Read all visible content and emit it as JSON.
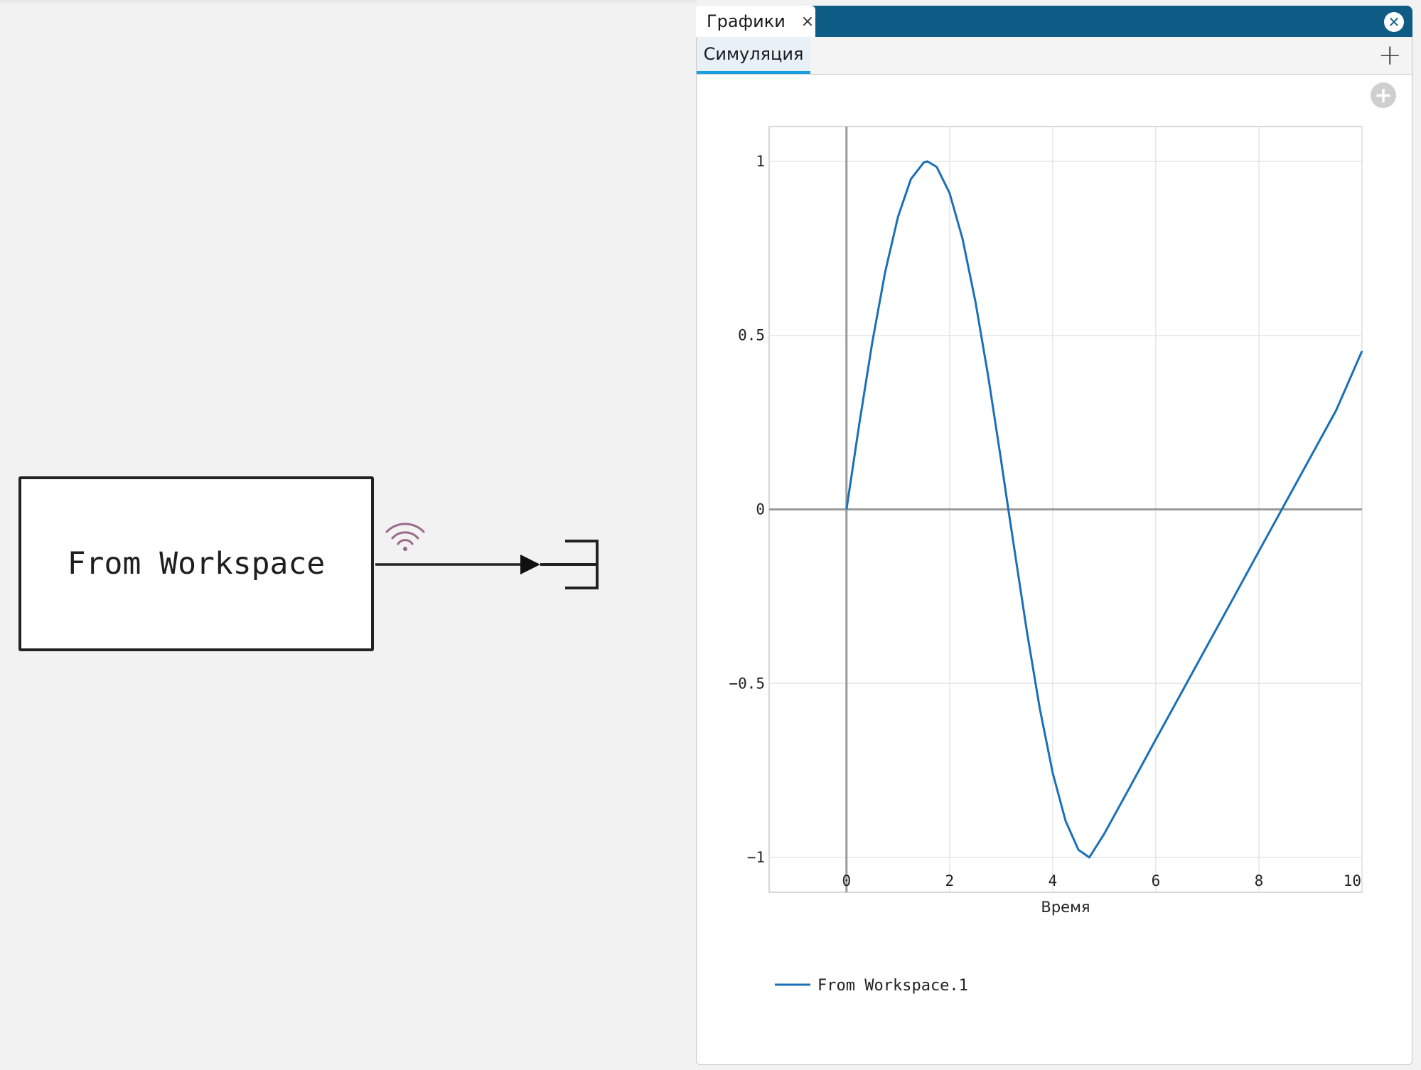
{
  "diagram": {
    "block_label": "From Workspace",
    "icons": {
      "signal": "wifi-signal-icon",
      "terminator": "terminator-bracket-icon"
    },
    "colors": {
      "block_border": "#222222",
      "signal_icon": "#9a6a8a",
      "line": "#222222"
    }
  },
  "panel": {
    "tab_label": "Графики",
    "tab_close": "×",
    "close_icon": "✕",
    "subtab_label": "Симуляция",
    "add_tab": "+",
    "add_plot": "+",
    "colors": {
      "header": "#0e5c85",
      "subtab_accent": "#1aa0e0"
    }
  },
  "chart_data": {
    "type": "line",
    "title": "",
    "xlabel": "Время",
    "ylabel": "",
    "xlim": [
      -1.5,
      10
    ],
    "ylim": [
      -1.1,
      1.1
    ],
    "x_ticks": [
      0,
      2,
      4,
      6,
      8,
      10
    ],
    "y_ticks": [
      1,
      0.5,
      0,
      -0.5,
      -1
    ],
    "x_tick_labels": [
      "0",
      "2",
      "4",
      "6",
      "8",
      "10"
    ],
    "y_tick_labels": [
      "1",
      "0.5",
      "0",
      "−0.5",
      "−1"
    ],
    "grid": true,
    "legend_position": "bottom-left",
    "series": [
      {
        "name": "From Workspace.1",
        "color": "#1a70b8",
        "x": [
          0,
          0.25,
          0.5,
          0.75,
          1.0,
          1.25,
          1.5,
          1.57,
          1.75,
          2.0,
          2.25,
          2.5,
          2.75,
          3.0,
          3.14,
          3.25,
          3.5,
          3.75,
          4.0,
          4.25,
          4.5,
          4.71,
          5.0,
          5.5,
          6.0,
          6.5,
          7.0,
          7.5,
          8.0,
          8.5,
          9.0,
          9.5,
          10.0
        ],
        "y": [
          0,
          0.247,
          0.479,
          0.682,
          0.841,
          0.949,
          0.997,
          1.0,
          0.984,
          0.909,
          0.778,
          0.598,
          0.382,
          0.141,
          0.0,
          -0.108,
          -0.351,
          -0.572,
          -0.757,
          -0.895,
          -0.978,
          -1.0,
          -0.932,
          -0.797,
          -0.661,
          -0.526,
          -0.391,
          -0.256,
          -0.12,
          0.015,
          0.15,
          0.285,
          0.455
        ]
      }
    ]
  }
}
